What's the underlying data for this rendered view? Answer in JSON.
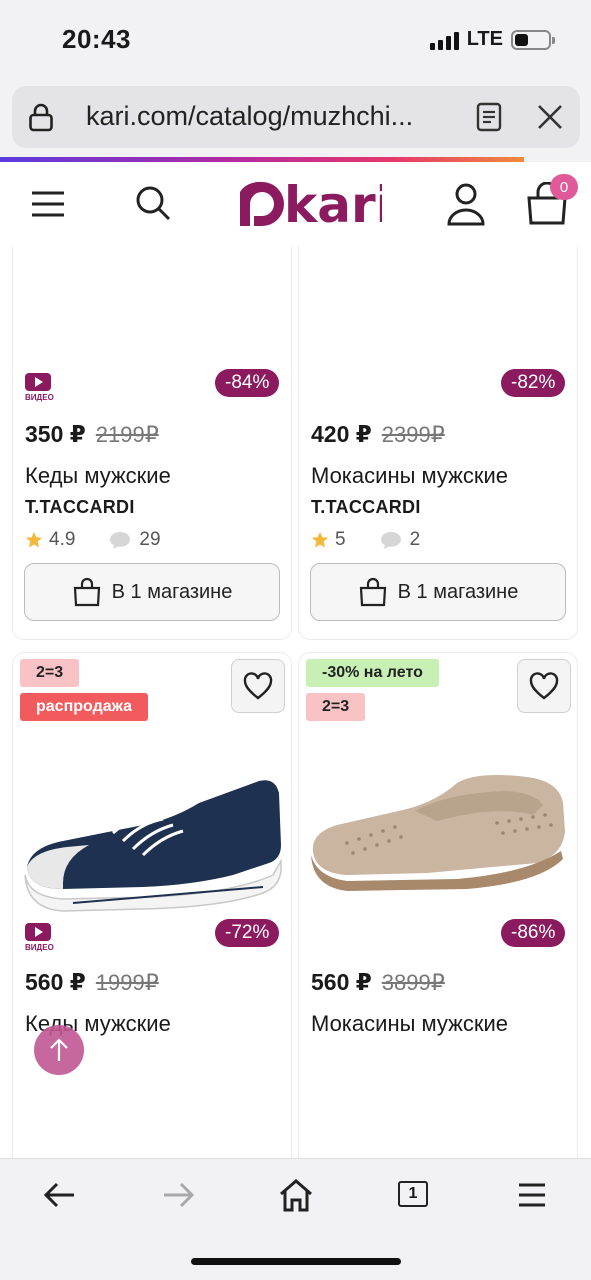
{
  "status": {
    "time": "20:43",
    "network": "LTE"
  },
  "browser": {
    "url": "kari.com/catalog/muzhchi..."
  },
  "header": {
    "logo_alt": "kari",
    "cart_count": "0"
  },
  "products": [
    {
      "video_label": "ВИДЕО",
      "discount": "-84%",
      "price": "350 ₽",
      "old_price": "2199₽",
      "name": "Кеды мужские",
      "brand": "T.TACCARDI",
      "rating": "4.9",
      "reviews": "29",
      "store_label": "В 1 магазине"
    },
    {
      "discount": "-82%",
      "price": "420 ₽",
      "old_price": "2399₽",
      "name": "Мокасины мужские",
      "brand": "T.TACCARDI",
      "rating": "5",
      "reviews": "2",
      "store_label": "В 1 магазине"
    },
    {
      "tags": [
        "2=3",
        "распродажа"
      ],
      "video_label": "ВИДЕО",
      "discount": "-72%",
      "price": "560 ₽",
      "old_price": "1999₽",
      "name": "Кеды мужские"
    },
    {
      "tags": [
        "-30% на лето",
        "2=3"
      ],
      "discount": "-86%",
      "price": "560 ₽",
      "old_price": "3899₽",
      "name": "Мокасины мужские"
    }
  ],
  "bottom_nav": {
    "tabs_count": "1"
  },
  "colors": {
    "brand": "#8b1b5e",
    "sale_tag": "#f25b5e",
    "promo_tag": "#f9c3c6",
    "summer_tag": "#c8f0b5"
  }
}
